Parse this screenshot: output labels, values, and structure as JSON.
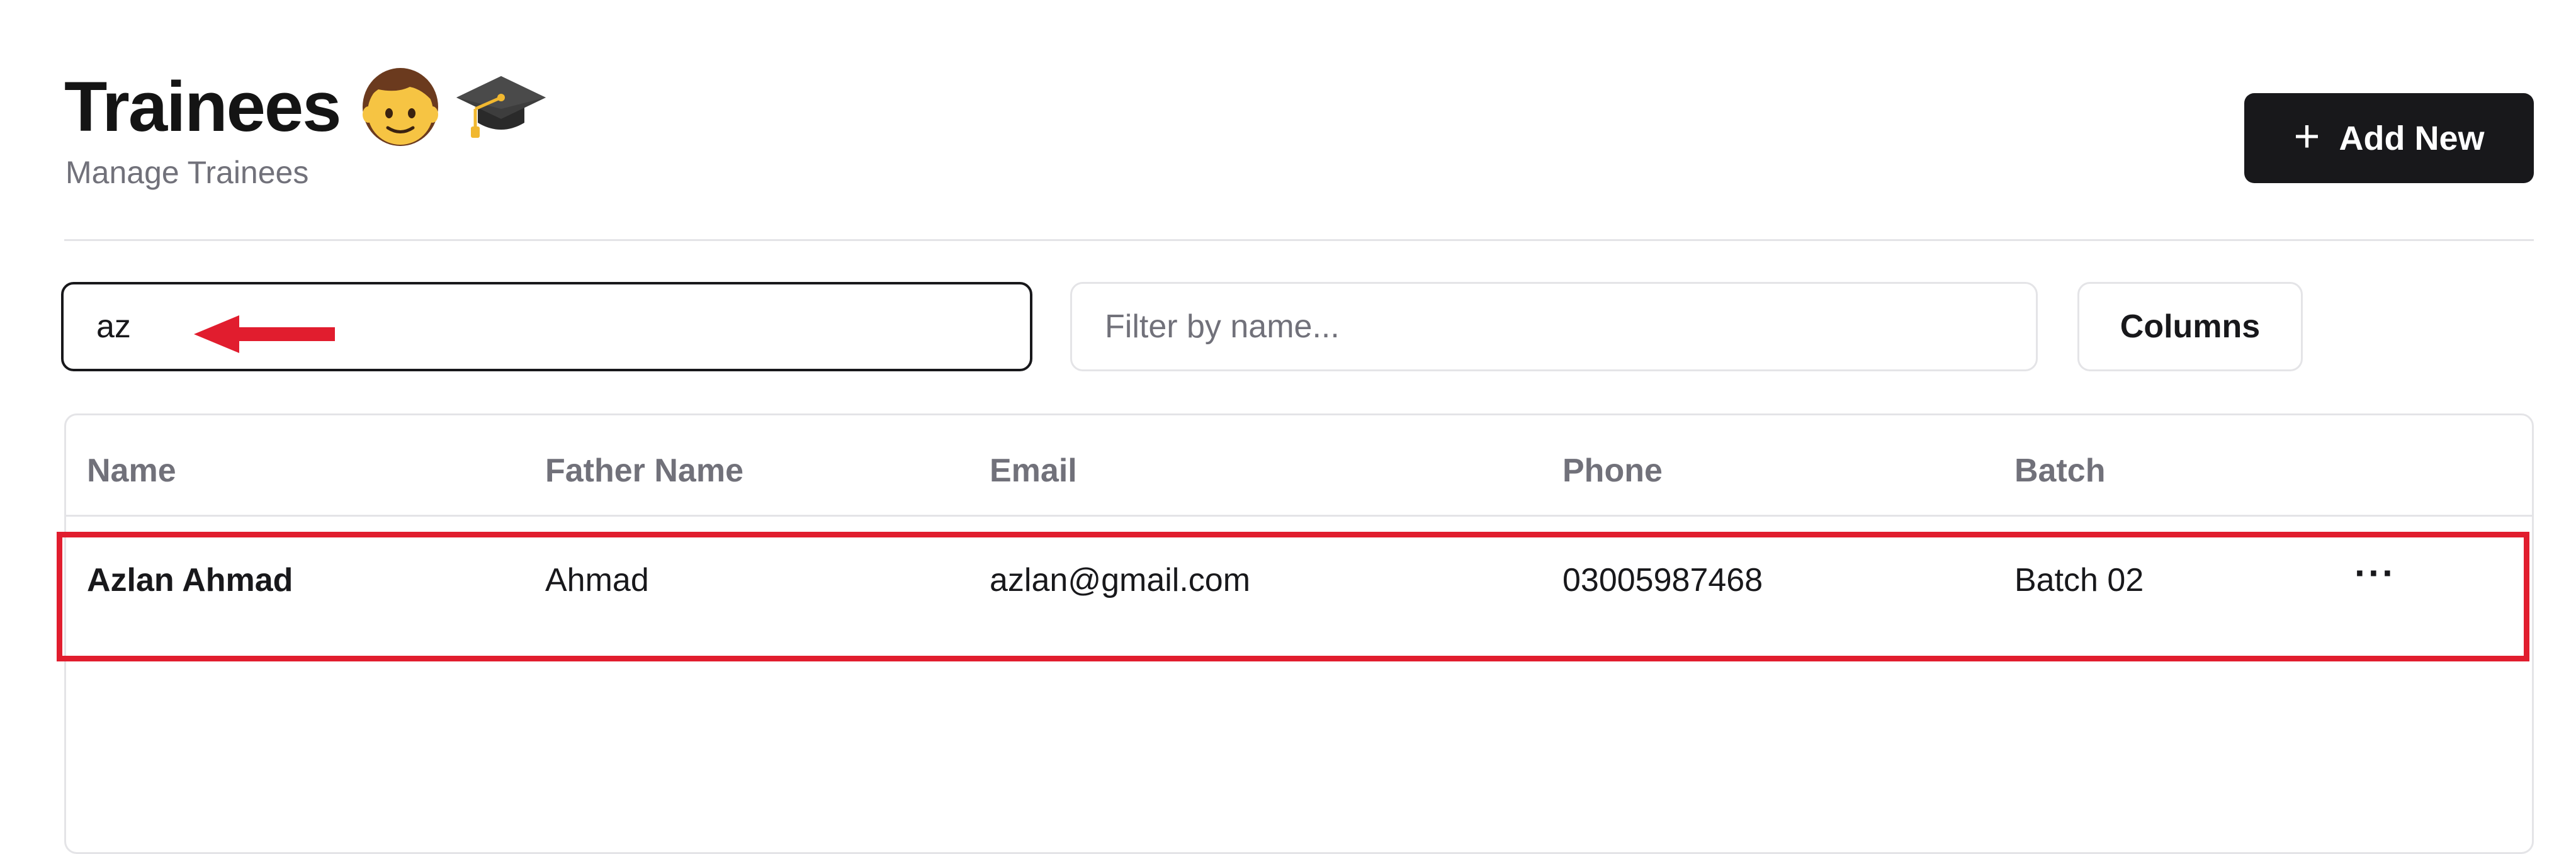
{
  "header": {
    "title": "Trainees",
    "subtitle": "Manage Trainees",
    "title_icons": [
      "boy-emoji-icon",
      "graduation-cap-icon"
    ],
    "add_button": {
      "label": "Add New",
      "icon": "plus-icon"
    }
  },
  "search": {
    "value": "az"
  },
  "filter": {
    "placeholder": "Filter by name..."
  },
  "columns_button": {
    "label": "Columns"
  },
  "table": {
    "columns": [
      "Name",
      "Father Name",
      "Email",
      "Phone",
      "Batch"
    ],
    "rows": [
      {
        "name": "Azlan Ahmad",
        "father_name": "Ahmad",
        "email": "azlan@gmail.com",
        "phone": "03005987468",
        "batch": "Batch 02",
        "actions_icon": "more-horizontal-icon"
      }
    ]
  },
  "annotations": {
    "arrow": "red-arrow-left-icon",
    "row_highlight": "red-rectangle-highlight"
  },
  "colors": {
    "primary": "#18181b",
    "muted": "#71717a",
    "border": "#e4e4e7",
    "annotation_red": "#e11d2e"
  }
}
